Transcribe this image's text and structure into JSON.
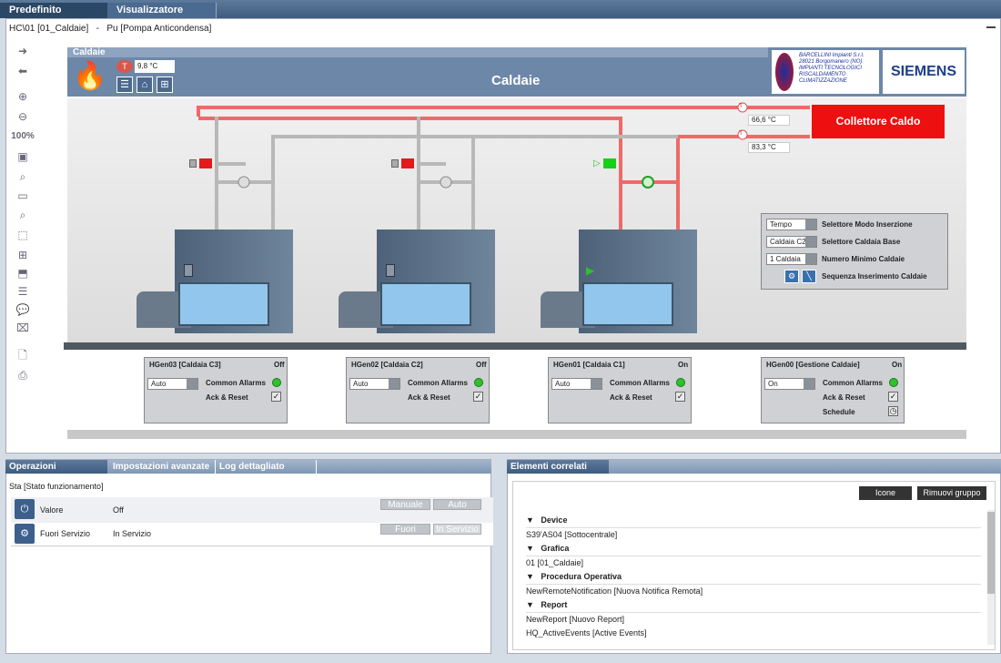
{
  "tabs": [
    {
      "label": "Predefinito"
    },
    {
      "label": "Visualizzatore Testuale"
    }
  ],
  "breadcrumb": {
    "path": "HC\\01 [01_Caldaie]",
    "sep": "-",
    "item": "Pu [Pompa Anticondensa]"
  },
  "toolbar": {
    "zoom": "100%"
  },
  "graphic": {
    "header_label": "Caldaie",
    "title": "Caldaie",
    "temp_badge": "9,8 °C",
    "company": [
      "BARCELLINI Impianti S.r.l.",
      "28021 Borgomanero (NO)",
      "IMPIANTI TECNOLOGICI",
      "RISCALDAMENTO",
      "CLIMATIZZAZIONE"
    ],
    "brand": "SIEMENS",
    "collettore": "Collettore Caldo",
    "temp1": "66,6 °C",
    "temp2": "83,3 °C",
    "selector": {
      "rows": [
        {
          "value": "Tempo",
          "label": "Selettore Modo Inserzione"
        },
        {
          "value": "Caldaia C2",
          "label": "Selettore Caldaia Base"
        },
        {
          "value": "1 Caldaia",
          "label": "Numero Minimo Caldaie"
        }
      ],
      "seq_label": "Sequenza Inserimento Caldaie"
    },
    "boilers": [
      {
        "name": "HGen03 [Caldaia C3]",
        "state": "Off",
        "mode": "Auto",
        "alarm": "Common Allarms",
        "reset": "Ack & Reset"
      },
      {
        "name": "HGen02 [Caldaia C2]",
        "state": "Off",
        "mode": "Auto",
        "alarm": "Common Allarms",
        "reset": "Ack & Reset"
      },
      {
        "name": "HGen01 [Caldaia C1]",
        "state": "On",
        "mode": "Auto",
        "alarm": "Common Allarms",
        "reset": "Ack & Reset"
      }
    ],
    "gestione": {
      "name": "HGen00 [Gestione Caldaie]",
      "state": "On",
      "mode": "On",
      "alarm": "Common Allarms",
      "reset": "Ack & Reset",
      "schedule": "Schedule"
    }
  },
  "operations": {
    "tabs": [
      "Operazioni",
      "Impostazioni avanzate",
      "Log dettagliato"
    ],
    "title": "Sta [Stato funzionamento]",
    "rows": [
      {
        "label": "Valore",
        "value": "Off",
        "btn1": "Manuale",
        "btn2": "Auto"
      },
      {
        "label": "Fuori Servizio",
        "value": "In Servizio",
        "btn1": "Fuori servi...",
        "btn2": "In Servizio"
      }
    ]
  },
  "related": {
    "title": "Elementi correlati",
    "buttons": {
      "icons": "Icone",
      "remove": "Rimuovi gruppo"
    },
    "groups": [
      {
        "name": "Device",
        "items": [
          "S39'AS04 [Sottocentrale]"
        ]
      },
      {
        "name": "Grafica",
        "items": [
          "01 [01_Caldaie]"
        ]
      },
      {
        "name": "Procedura Operativa",
        "items": [
          "NewRemoteNotification [Nuova Notifica Remota]"
        ]
      },
      {
        "name": "Report",
        "items": [
          "NewReport [Nuovo Report]",
          "HQ_ActiveEvents [Active Events]"
        ]
      }
    ]
  }
}
